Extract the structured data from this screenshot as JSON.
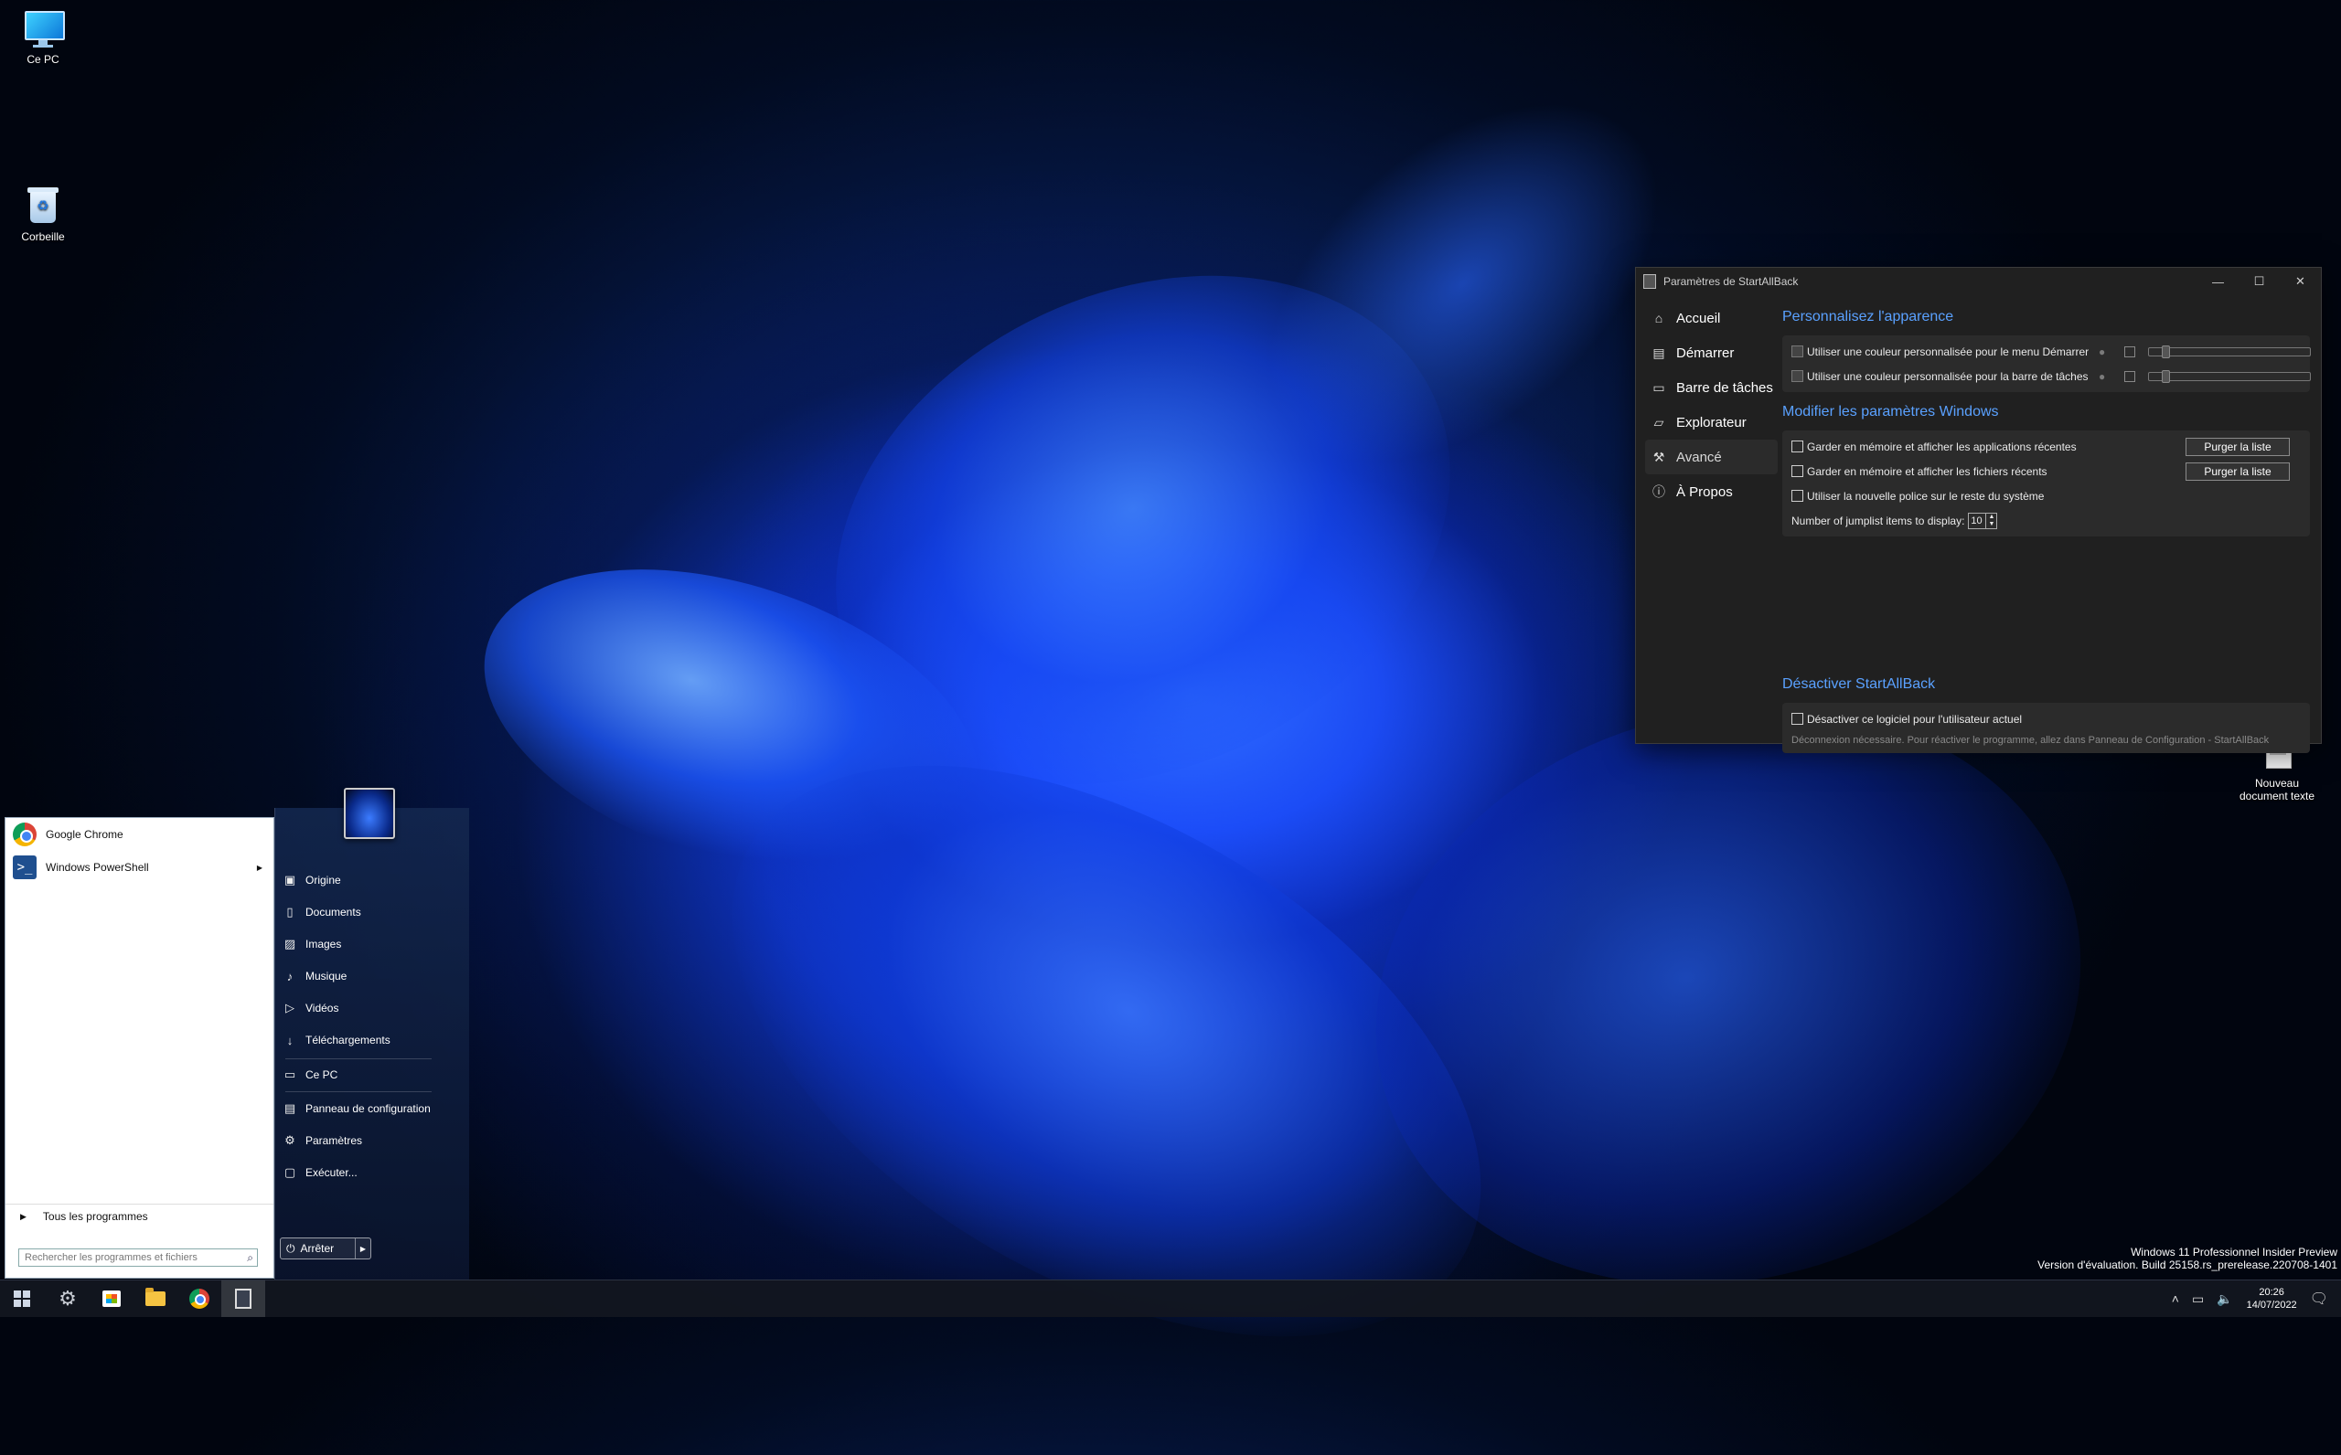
{
  "desktop": {
    "icons": {
      "this_pc": "Ce PC",
      "recycle_bin": "Corbeille",
      "new_doc_line1": "Nouveau",
      "new_doc_line2": "document texte"
    },
    "watermark": {
      "line1": "Windows 11 Professionnel Insider Preview",
      "line2": "Version d'évaluation. Build 25158.rs_prerelease.220708-1401"
    }
  },
  "settings_window": {
    "title": "Paramètres de StartAllBack",
    "nav": [
      {
        "label": "Accueil",
        "icon": "home-icon"
      },
      {
        "label": "Démarrer",
        "icon": "start-menu-icon"
      },
      {
        "label": "Barre de tâches",
        "icon": "taskbar-icon"
      },
      {
        "label": "Explorateur",
        "icon": "folder-icon"
      },
      {
        "label": "Avancé",
        "icon": "wrench-icon"
      },
      {
        "label": "À Propos",
        "icon": "info-icon"
      }
    ],
    "active_nav": "Avancé",
    "appearance": {
      "heading": "Personnalisez l'apparence",
      "start_color_label": "Utiliser une couleur personnalisée pour le menu Démarrer",
      "taskbar_color_label": "Utiliser une couleur personnalisée pour la barre de tâches"
    },
    "windows_params": {
      "heading": "Modifier les paramètres Windows",
      "recent_apps_label": "Garder en mémoire et afficher les applications récentes",
      "recent_files_label": "Garder en mémoire et afficher les fichiers récents",
      "new_font_label": "Utiliser la nouvelle police sur le reste du système",
      "purge_label": "Purger la liste",
      "jumplist_label": "Number of jumplist items to display:",
      "jumplist_value": "10"
    },
    "disable": {
      "heading": "Désactiver StartAllBack",
      "checkbox_label": "Désactiver ce logiciel pour l'utilisateur actuel",
      "note": "Déconnexion nécessaire. Pour réactiver le programme, allez dans Panneau de Configuration - StartAllBack"
    }
  },
  "start_menu": {
    "programs": [
      {
        "label": "Google Chrome"
      },
      {
        "label": "Windows PowerShell"
      }
    ],
    "all_programs": "Tous les programmes",
    "search_placeholder": "Rechercher les programmes et fichiers",
    "places": [
      {
        "label": "Origine",
        "icon": "user-folder-icon"
      },
      {
        "label": "Documents",
        "icon": "documents-icon"
      },
      {
        "label": "Images",
        "icon": "images-icon"
      },
      {
        "label": "Musique",
        "icon": "music-icon"
      },
      {
        "label": "Vidéos",
        "icon": "videos-icon"
      },
      {
        "label": "Téléchargements",
        "icon": "downloads-icon"
      },
      {
        "label": "Ce PC",
        "icon": "computer-icon"
      },
      {
        "label": "Panneau de configuration",
        "icon": "control-panel-icon"
      },
      {
        "label": "Paramètres",
        "icon": "gear-icon"
      },
      {
        "label": "Exécuter...",
        "icon": "run-icon"
      }
    ],
    "shutdown_label": "Arrêter"
  },
  "taskbar": {
    "time": "20:26",
    "date": "14/07/2022"
  }
}
